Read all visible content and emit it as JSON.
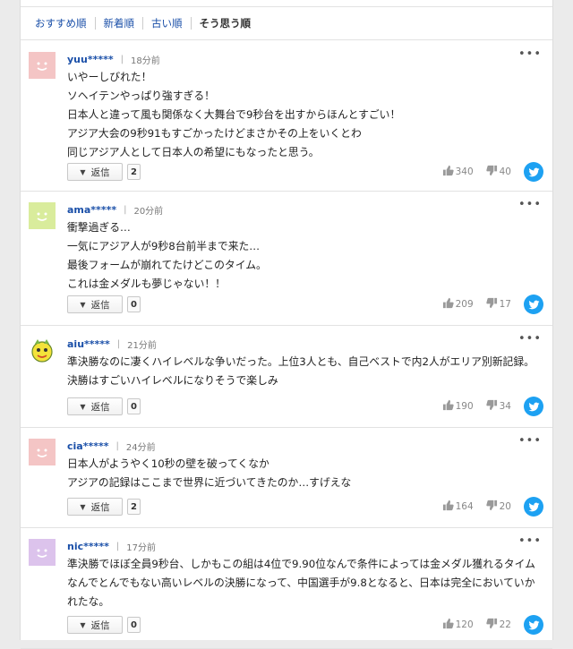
{
  "tabs": [
    {
      "label": "おすすめ順"
    },
    {
      "label": "新着順"
    },
    {
      "label": "古い順"
    },
    {
      "label": "そう思う順"
    }
  ],
  "reply_label": "返信",
  "colors": {
    "link": "#1a4fa8",
    "twitter": "#1da1f2"
  },
  "comments": [
    {
      "user": "yuu*****",
      "time": "18分前",
      "avatar": {
        "icon": "default-avatar-icon",
        "color": "#f4c5c5"
      },
      "lines": [
        "いやーしびれた！",
        "ソヘイテンやっぱり強すぎる！",
        "日本人と違って風も関係なく大舞台で9秒台を出すからほんとすごい！",
        "アジア大会の9秒91もすごかったけどまさかその上をいくとわ",
        "同じアジア人として日本人の希望にもなったと思う。"
      ],
      "replies": "2",
      "likes": "340",
      "dislikes": "40"
    },
    {
      "user": "ama*****",
      "time": "20分前",
      "avatar": {
        "icon": "default-avatar-icon",
        "color": "#d9ec9c"
      },
      "lines": [
        "衝撃過ぎる…",
        "一気にアジア人が9秒8台前半まで来た…",
        "最後フォームが崩れてたけどこのタイム。",
        "これは金メダルも夢じゃない！！"
      ],
      "replies": "0",
      "likes": "209",
      "dislikes": "17"
    },
    {
      "user": "aiu*****",
      "time": "21分前",
      "avatar": {
        "icon": "character-avatar-icon",
        "color": "#f3e23a"
      },
      "lines": [
        "準決勝なのに凄くハイレベルな争いだった。上位3人とも、自己ベストで内2人がエリア別新記録。決勝はすごいハイレベルになりそうで楽しみ"
      ],
      "replies": "0",
      "likes": "190",
      "dislikes": "34"
    },
    {
      "user": "cia*****",
      "time": "24分前",
      "avatar": {
        "icon": "default-avatar-icon",
        "color": "#f4c5c5"
      },
      "lines": [
        "日本人がようやく10秒の壁を破ってくなか",
        "アジアの記録はここまで世界に近づいてきたのか…すげえな"
      ],
      "replies": "2",
      "likes": "164",
      "dislikes": "20"
    },
    {
      "user": "nic*****",
      "time": "17分前",
      "avatar": {
        "icon": "default-avatar-icon",
        "color": "#dcc3ec"
      },
      "lines": [
        "準決勝でほぼ全員9秒台、しかもこの組は4位で9.90位なんで条件によっては金メダル獲れるタイムなんでとんでもない高いレベルの決勝になって、中国選手が9.8となると、日本は完全においていかれたな。"
      ],
      "replies": "0",
      "likes": "120",
      "dislikes": "22"
    }
  ]
}
